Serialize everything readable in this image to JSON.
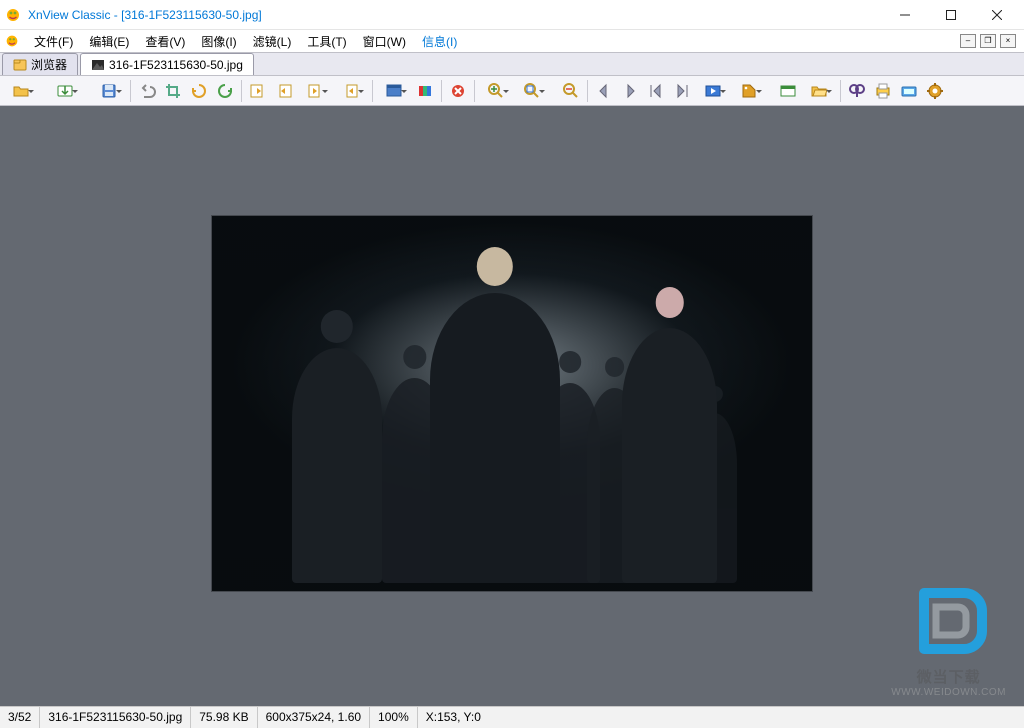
{
  "title": "XnView Classic - [316-1F523115630-50.jpg]",
  "menu": {
    "file": "文件(F)",
    "edit": "编辑(E)",
    "view": "查看(V)",
    "image": "图像(I)",
    "filter": "滤镜(L)",
    "tools": "工具(T)",
    "window": "窗口(W)",
    "info": "信息(I)"
  },
  "tabs": {
    "browser": "浏览器",
    "image": "316-1F523115630-50.jpg"
  },
  "status": {
    "index": "3/52",
    "filename": "316-1F523115630-50.jpg",
    "filesize": "75.98 KB",
    "dimensions": "600x375x24, 1.60",
    "zoom": "100%",
    "coords": "X:153, Y:0"
  },
  "watermark": {
    "text": "微当下载",
    "url": "WWW.WEIDOWN.COM"
  }
}
